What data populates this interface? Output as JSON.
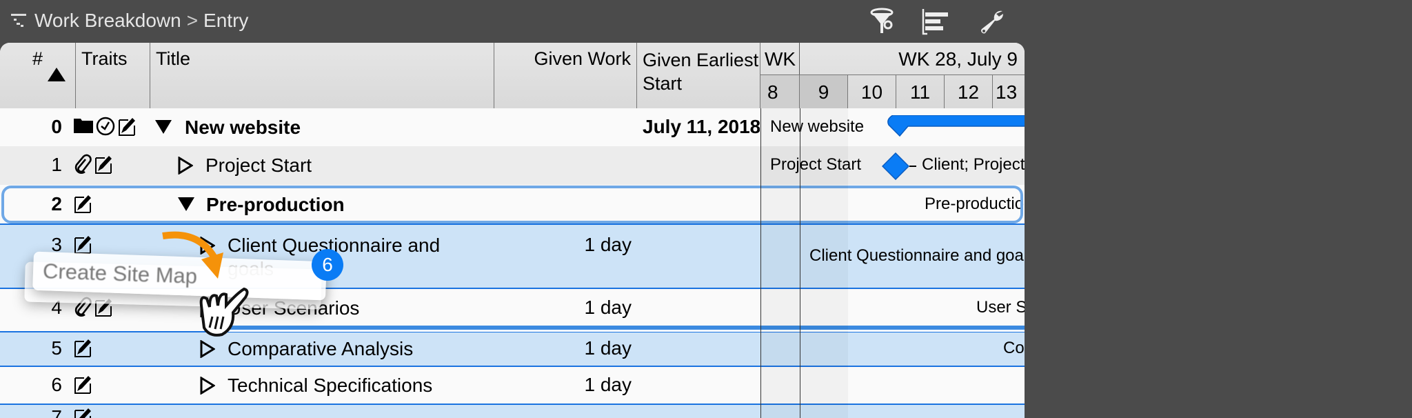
{
  "toolbar": {
    "breadcrumb": [
      {
        "label": "Work Breakdown"
      },
      {
        "label": "Entry"
      }
    ],
    "breadcrumb_separator": ">",
    "icons": [
      "outline-icon",
      "filter-icon",
      "gantt-view-icon",
      "wrench-icon"
    ]
  },
  "columns": {
    "number": "#",
    "traits": "Traits",
    "title": "Title",
    "given_work": "Given Work",
    "given_earliest_start": "Given Earliest Start",
    "sort": "ascending"
  },
  "timeline": {
    "prev_week": "WK",
    "week": "WK 28, July 9",
    "days": [
      "8",
      "9",
      "10",
      "11",
      "12",
      "13"
    ]
  },
  "rows": [
    {
      "num": "0",
      "traits": [
        "folder",
        "clock",
        "note"
      ],
      "expanded": true,
      "title": "New website",
      "work": "",
      "start": "July 11, 2018",
      "bar_label": "New website",
      "bold": true
    },
    {
      "num": "1",
      "traits": [
        "attachment",
        "note"
      ],
      "expanded": false,
      "title": "Project Start",
      "work": "",
      "start": "",
      "bar_label": "Project Start",
      "resources": "Client; Project",
      "bold": false
    },
    {
      "num": "2",
      "traits": [
        "note"
      ],
      "expanded": true,
      "title": "Pre-production",
      "work": "",
      "start": "",
      "bar_label": "Pre-production",
      "bold": true,
      "focused": true
    },
    {
      "num": "3",
      "traits": [
        "note"
      ],
      "expanded": false,
      "title": "Client Questionnaire and goals",
      "work": "1 day",
      "start": "",
      "bar_label": "Client Questionnaire and goals",
      "selected": true
    },
    {
      "num": "4",
      "traits": [
        "attachment",
        "note"
      ],
      "expanded": false,
      "title": "User Scenarios",
      "work": "1 day",
      "start": "",
      "bar_label": "User Scenarios"
    },
    {
      "num": "5",
      "traits": [
        "note"
      ],
      "expanded": false,
      "title": "Comparative Analysis",
      "work": "1 day",
      "start": "",
      "bar_label": "Comparative Analysis",
      "selected": true
    },
    {
      "num": "6",
      "traits": [
        "note"
      ],
      "expanded": false,
      "title": "Technical Specifications",
      "work": "1 day",
      "start": "",
      "bar_label": ""
    },
    {
      "num": "7",
      "traits": [
        "note"
      ],
      "expanded": false,
      "title": "",
      "work": "",
      "start": "",
      "selected": true
    }
  ],
  "drag": {
    "item_label": "Create Site Map",
    "count_badge": "6"
  },
  "colors": {
    "selection": "#cde3f7",
    "accent": "#1a73e0",
    "bar": "#0a7cf5",
    "drag_arrow": "#f5920a"
  }
}
